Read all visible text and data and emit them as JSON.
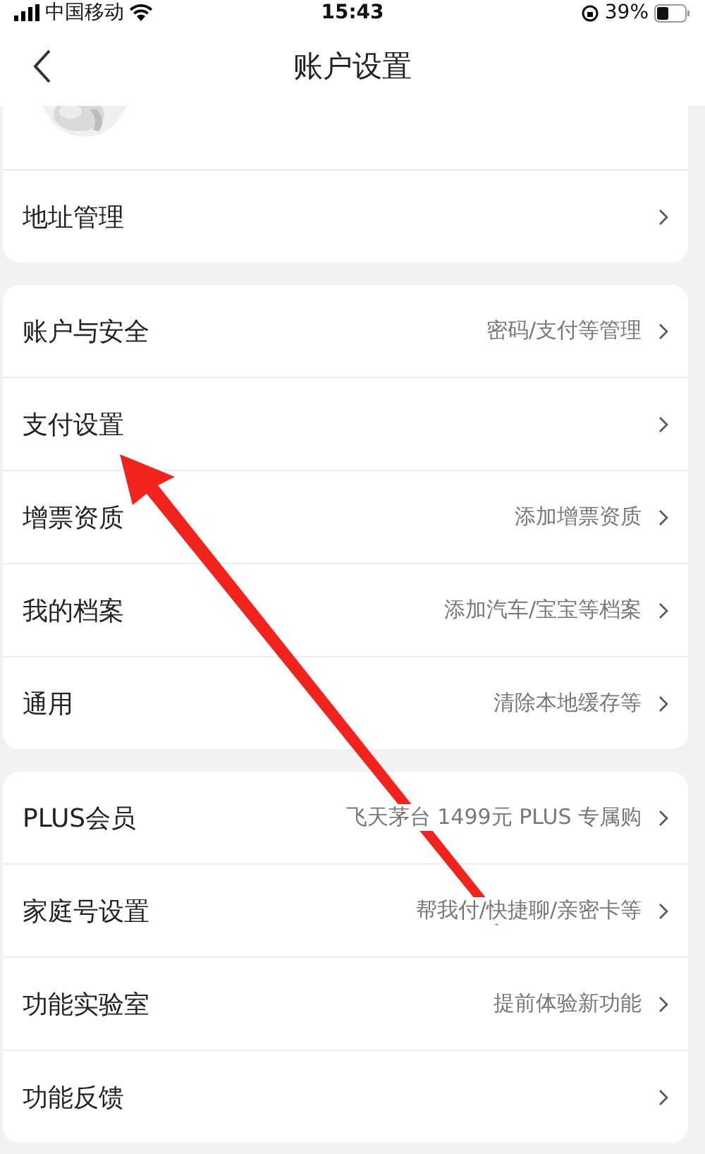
{
  "status_bar": {
    "carrier": "中国移动",
    "time": "15:43",
    "battery": "39%"
  },
  "nav": {
    "title": "账户设置"
  },
  "groups": [
    {
      "rows": [
        {
          "label": "地址管理"
        }
      ]
    },
    {
      "rows": [
        {
          "label": "账户与安全",
          "value": "密码/支付等管理"
        },
        {
          "label": "支付设置"
        },
        {
          "label": "增票资质",
          "value": "添加增票资质"
        },
        {
          "label": "我的档案",
          "value": "添加汽车/宝宝等档案"
        },
        {
          "label": "通用",
          "value": "清除本地缓存等"
        }
      ]
    },
    {
      "rows": [
        {
          "label": "PLUS会员",
          "value": "飞天茅台 1499元 PLUS 专属购"
        },
        {
          "label": "家庭号设置",
          "value": "帮我付/快捷聊/亲密卡等"
        },
        {
          "label": "功能实验室",
          "value": "提前体验新功能"
        },
        {
          "label": "功能反馈"
        }
      ]
    }
  ]
}
